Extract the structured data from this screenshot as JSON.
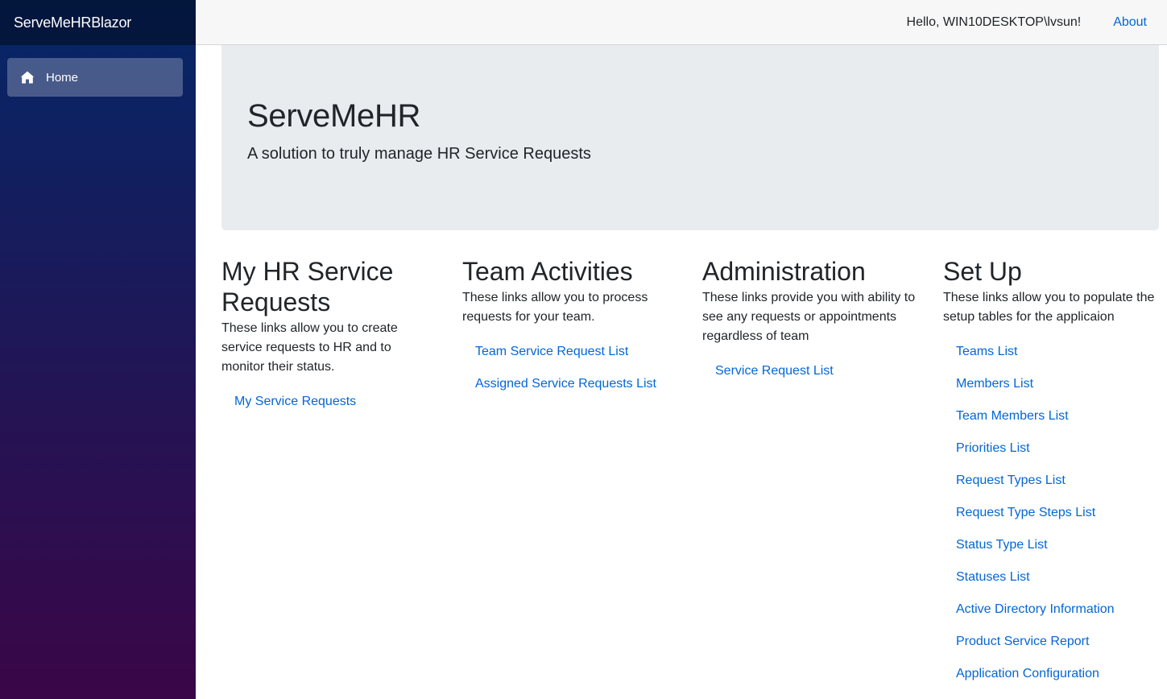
{
  "sidebar": {
    "brand": "ServeMeHRBlazor",
    "items": [
      {
        "label": "Home",
        "icon": "home-icon",
        "active": true
      }
    ]
  },
  "top_row": {
    "greeting": "Hello, WIN10DESKTOP\\lvsun!",
    "about": "About"
  },
  "jumbotron": {
    "title": "ServeMeHR",
    "lead": "A solution to truly manage HR Service Requests"
  },
  "sections": [
    {
      "title": "My HR Service Requests",
      "description": "These links allow you to create service requests to HR and to monitor their status.",
      "links": [
        "My Service Requests"
      ]
    },
    {
      "title": "Team Activities",
      "description": "These links allow you to process requests for your team.",
      "links": [
        "Team Service Request List",
        "Assigned Service Requests List"
      ]
    },
    {
      "title": "Administration",
      "description": "These links provide you with ability to see any requests or appointments regardless of team",
      "links": [
        "Service Request List"
      ]
    },
    {
      "title": "Set Up",
      "description": "These links allow you to populate the setup tables for the applicaion",
      "links": [
        "Teams List",
        "Members List",
        "Team Members List",
        "Priorities List",
        "Request Types List",
        "Request Type Steps List",
        "Status Type List",
        "Statuses List",
        "Active Directory Information",
        "Product Service Report",
        "Application Configuration"
      ]
    }
  ],
  "colors": {
    "link": "#0366d6",
    "sidebar_top": "#052767",
    "sidebar_bottom": "#3a0647",
    "jumbotron_bg": "#e9ecef",
    "top_row_bg": "#f7f7f7"
  }
}
